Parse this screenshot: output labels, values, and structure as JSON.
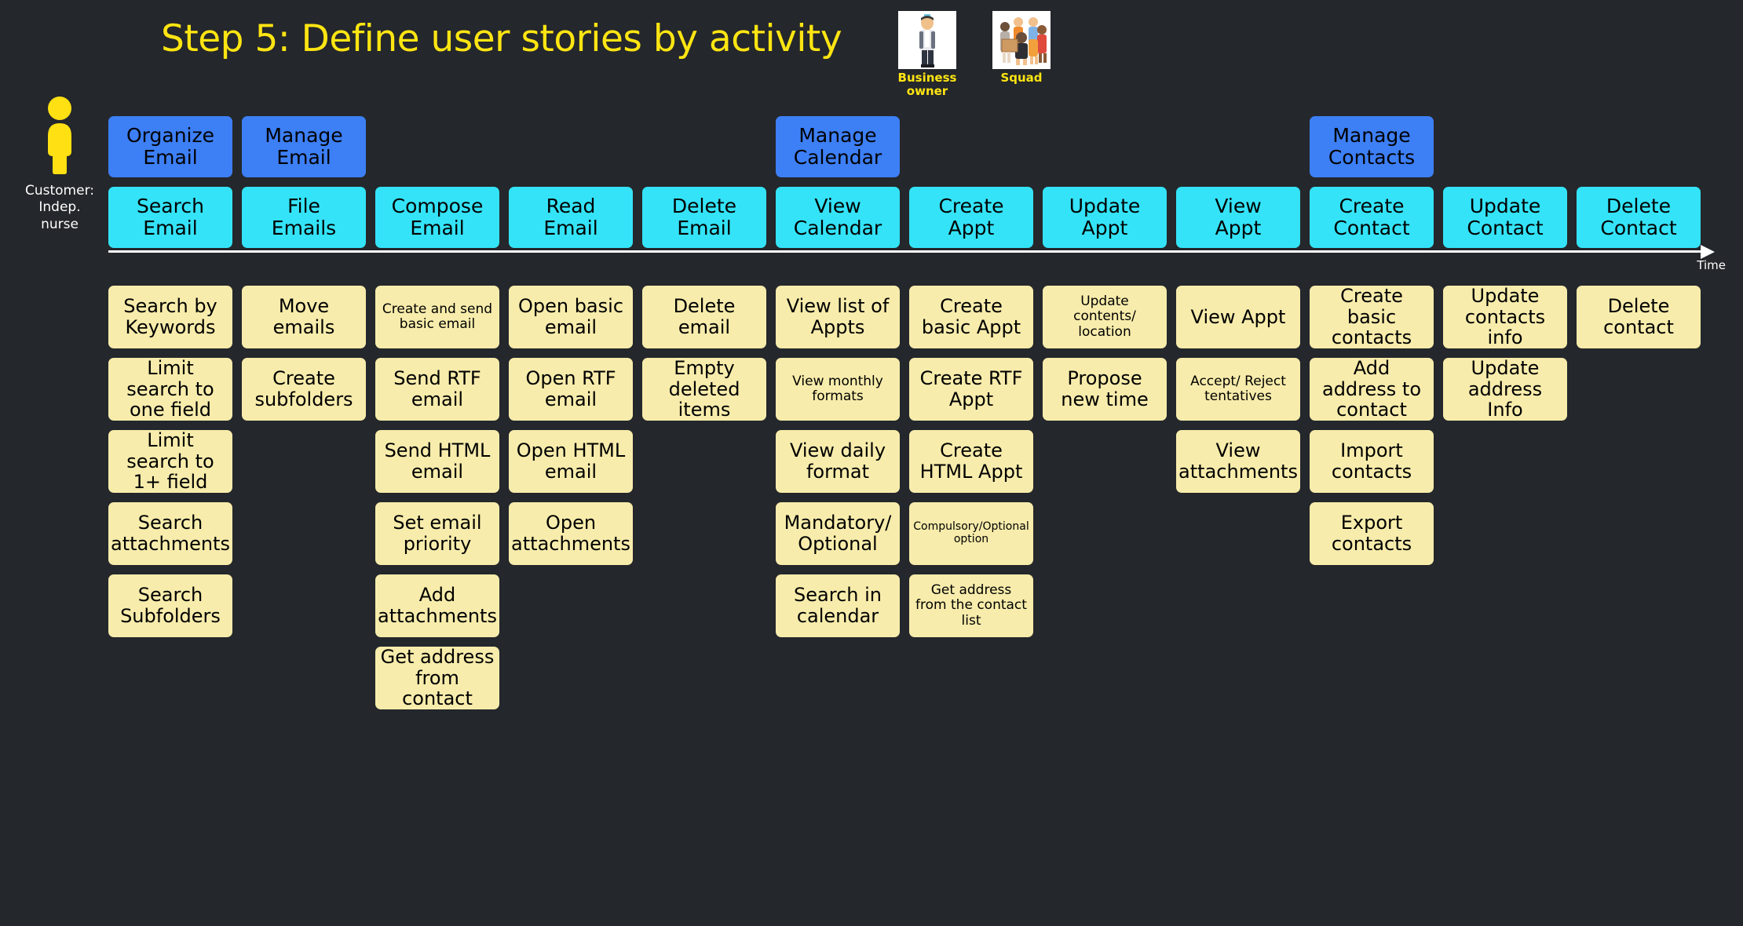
{
  "title": "Step 5: Define user stories by activity",
  "colors": {
    "background": "#24272b",
    "title": "#ffe512",
    "activity": "#3d7ff5",
    "task": "#34e3f7",
    "story": "#f7ecab",
    "persona_label": "#ffe512",
    "customer_label": "#ffffff",
    "timeline": "#ffffff"
  },
  "personas": [
    {
      "label": "Business\nowner",
      "icon": "business-owner-figure"
    },
    {
      "label": "Squad",
      "icon": "squad-group-figure"
    }
  ],
  "customer": {
    "icon": "person-figure-icon",
    "label": "Customer:\nIndep.\nnurse"
  },
  "timeline": {
    "label": "Time"
  },
  "columns": [
    {
      "task": "Search\nEmail",
      "activity": "Organize\nEmail",
      "stories": [
        "Search by Keywords",
        "Limit search to one field",
        "Limit search to 1+ field",
        "Search attachments",
        "Search Subfolders",
        ""
      ]
    },
    {
      "task": "File\nEmails",
      "activity": "Manage\nEmail",
      "stories": [
        "Move emails",
        "Create subfolders",
        "",
        "",
        "",
        ""
      ]
    },
    {
      "task": "Compose\nEmail",
      "activity": "",
      "stories": [
        "Create and send basic email",
        "Send RTF email",
        "Send HTML email",
        "Set email priority",
        "Add attachments",
        "Get address from contact"
      ]
    },
    {
      "task": "Read\nEmail",
      "activity": "",
      "stories": [
        "Open basic email",
        "Open RTF email",
        "Open HTML email",
        "Open attachments",
        "",
        ""
      ]
    },
    {
      "task": "Delete\nEmail",
      "activity": "",
      "stories": [
        "Delete email",
        "Empty deleted items",
        "",
        "",
        "",
        ""
      ]
    },
    {
      "task": "View\nCalendar",
      "activity": "Manage\nCalendar",
      "stories": [
        "View list of Appts",
        "View monthly formats",
        "View daily format",
        "Mandatory/ Optional",
        "Search in calendar",
        ""
      ]
    },
    {
      "task": "Create\nAppt",
      "activity": "",
      "stories": [
        "Create basic Appt",
        "Create RTF Appt",
        "Create HTML Appt",
        "Compulsory/Optional option",
        "Get address from the contact list",
        ""
      ]
    },
    {
      "task": "Update\nAppt",
      "activity": "",
      "stories": [
        "Update contents/ location",
        "Propose new time",
        "",
        "",
        "",
        ""
      ]
    },
    {
      "task": "View\nAppt",
      "activity": "",
      "stories": [
        "View Appt",
        "Accept/ Reject tentatives",
        "View attachments",
        "",
        "",
        ""
      ]
    },
    {
      "task": "Create\nContact",
      "activity": "Manage\nContacts",
      "stories": [
        "Create basic contacts",
        "Add address to contact",
        "Import contacts",
        "Export contacts",
        "",
        ""
      ]
    },
    {
      "task": "Update\nContact",
      "activity": "",
      "stories": [
        "Update contacts info",
        "Update address Info",
        "",
        "",
        "",
        ""
      ]
    },
    {
      "task": "Delete\nContact",
      "activity": "",
      "stories": [
        "Delete contact",
        "",
        "",
        "",
        "",
        ""
      ]
    }
  ],
  "story_font_overrides": {
    "Create and send basic email": "small",
    "Update contents/ location": "small",
    "View monthly formats": "small",
    "Accept/ Reject tentatives": "small",
    "Compulsory/Optional option": "tiny",
    "Get address from the contact list": "small"
  }
}
